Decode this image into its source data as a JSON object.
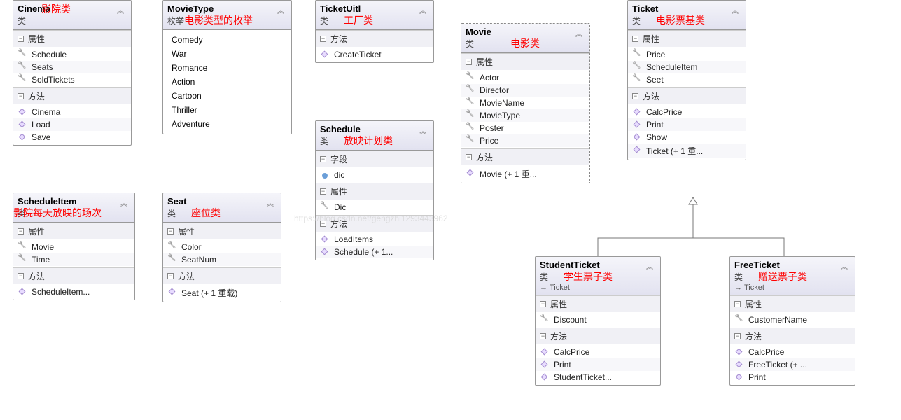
{
  "watermark": "https://blog.csdn.net/gengzhi1293443962",
  "type_label_class": "类",
  "type_label_enum": "枚举",
  "section_labels": {
    "properties": "属性",
    "methods": "方法",
    "fields": "字段"
  },
  "boxes": {
    "cinema": {
      "name": "Cinema",
      "type": "类",
      "red": "影院类",
      "properties": [
        "Schedule",
        "Seats",
        "SoldTickets"
      ],
      "methods": [
        "Cinema",
        "Load",
        "Save"
      ]
    },
    "movietype": {
      "name": "MovieType",
      "type": "枚举",
      "red": "电影类型的枚举",
      "enum": [
        "Comedy",
        "War",
        "Romance",
        "Action",
        "Cartoon",
        "Thriller",
        "Adventure"
      ]
    },
    "ticketuitl": {
      "name": "TicketUitl",
      "type": "类",
      "red": "工厂类",
      "methods": [
        "CreateTicket"
      ]
    },
    "schedule": {
      "name": "Schedule",
      "type": "类",
      "red": "放映计划类",
      "fields": [
        "dic"
      ],
      "properties": [
        "Dic"
      ],
      "methods": [
        "LoadItems",
        "Schedule (+ 1..."
      ]
    },
    "movie": {
      "name": "Movie",
      "type": "类",
      "red": "电影类",
      "properties": [
        "Actor",
        "Director",
        "MovieName",
        "MovieType",
        "Poster",
        "Price"
      ],
      "methods": [
        "Movie (+ 1 重..."
      ]
    },
    "ticket": {
      "name": "Ticket",
      "type": "类",
      "red": "电影票基类",
      "properties": [
        "Price",
        "ScheduleItem",
        "Seet"
      ],
      "methods": [
        "CalcPrice",
        "Print",
        "Show",
        "Ticket (+ 1 重..."
      ]
    },
    "scheduleitem": {
      "name": "ScheduleItem",
      "type": "类",
      "red": "影院每天放映的场次",
      "properties": [
        "Movie",
        "Time"
      ],
      "methods": [
        "ScheduleItem..."
      ]
    },
    "seat": {
      "name": "Seat",
      "type": "类",
      "red": "座位类",
      "properties": [
        "Color",
        "SeatNum"
      ],
      "methods": [
        "Seat (+ 1 重载)"
      ]
    },
    "studentticket": {
      "name": "StudentTicket",
      "type": "类",
      "inherits": "Ticket",
      "red": "学生票子类",
      "properties": [
        "Discount"
      ],
      "methods": [
        "CalcPrice",
        "Print",
        "StudentTicket..."
      ]
    },
    "freeticket": {
      "name": "FreeTicket",
      "type": "类",
      "inherits": "Ticket",
      "red": "赠送票子类",
      "properties": [
        "CustomerName"
      ],
      "methods": [
        "CalcPrice",
        "FreeTicket (+ ...",
        "Print"
      ]
    }
  }
}
